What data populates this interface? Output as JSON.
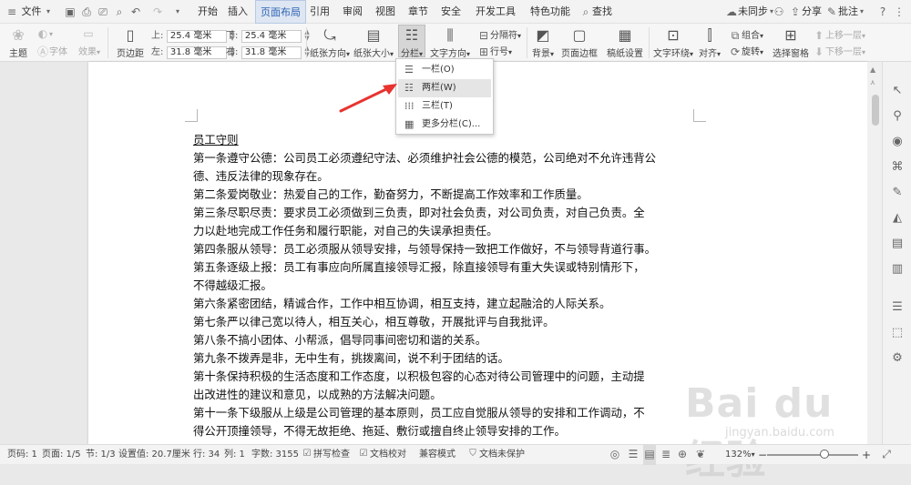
{
  "menubar": {
    "file_label": "文件",
    "tabs": [
      {
        "label": "开始"
      },
      {
        "label": "插入"
      },
      {
        "label": "页面布局",
        "active": true
      },
      {
        "label": "引用"
      },
      {
        "label": "审阅"
      },
      {
        "label": "视图"
      },
      {
        "label": "章节"
      },
      {
        "label": "安全"
      },
      {
        "label": "开发工具"
      },
      {
        "label": "特色功能"
      }
    ],
    "search_label": "查找",
    "sync_label": "未同步",
    "share_label": "分享",
    "comment_label": "批注"
  },
  "toolbar": {
    "theme_label": "主题",
    "font_label": "字体",
    "effect_label": "效果",
    "margin_button_label": "页边距",
    "margin_top_label": "上:",
    "margin_top_value": "25.4 毫米",
    "margin_bottom_label": "下:",
    "margin_bottom_value": "25.4 毫米",
    "margin_left_label": "左:",
    "margin_left_value": "31.8 毫米",
    "margin_right_label": "右:",
    "margin_right_value": "31.8 毫米",
    "orientation_label": "纸张方向",
    "size_label": "纸张大小",
    "columns_label": "分栏",
    "text_direction_label": "文字方向",
    "break_label": "分隔符",
    "line_number_label": "行号",
    "background_label": "背景",
    "page_border_label": "页面边框",
    "paper_setting_label": "稿纸设置",
    "text_wrap_label": "文字环绕",
    "align_label": "对齐",
    "rotate_label": "旋转",
    "group_label": "组合",
    "select_pane_label": "选择窗格",
    "bring_forward_label": "上移一层",
    "send_backward_label": "下移一层"
  },
  "columns_menu": {
    "items": [
      {
        "label": "一栏(O)"
      },
      {
        "label": "两栏(W)",
        "highlighted": true
      },
      {
        "label": "三栏(T)"
      },
      {
        "label": "更多分栏(C)..."
      }
    ]
  },
  "document": {
    "title": "员工守则",
    "paragraphs": [
      "第一条遵守公德：公司员工必须遵纪守法、必须维护社会公德的模范，公司绝对不允许违背公",
      "德、违反法律的现象存在。",
      "第二条爱岗敬业：热爱自己的工作，勤奋努力，不断提高工作效率和工作质量。",
      "第三条尽职尽责：要求员工必须做到三负责，即对社会负责，对公司负责，对自己负责。全",
      "力以赴地完成工作任务和履行职能，对自己的失误承担责任。",
      "第四条服从领导：员工必须服从领导安排，与领导保持一致把工作做好，不与领导背道行事。",
      "第五条逐级上报：员工有事应向所属直接领导汇报，除直接领导有重大失误或特别情形下，",
      "不得越级汇报。",
      "第六条紧密团结，精诚合作，工作中相互协调，相互支持，建立起融洽的人际关系。",
      "第七条严以律己宽以待人，相互关心，相互尊敬，开展批评与自我批评。",
      "第八条不搞小团体、小帮派，倡导同事间密切和谐的关系。",
      "第九条不拨弄是非，无中生有，挑拨离间，说不利于团结的话。",
      "第十条保持积极的生活态度和工作态度，以积极包容的心态对待公司管理中的问题，主动提",
      "出改进性的建议和意见，以成熟的方法解决问题。",
      "第十一条下级服从上级是公司管理的基本原则，员工应自觉服从领导的安排和工作调动，不",
      "得公开顶撞领导，不得无故拒绝、拖延、敷衍或擅自终止领导安排的工作。"
    ]
  },
  "statusbar": {
    "page_num": "页码: 1",
    "pages": "页面: 1/5",
    "section": "节: 1/3",
    "setting": "设置值: 20.7厘米",
    "row": "行: 34",
    "col": "列: 1",
    "words": "字数: 3155",
    "spell_check": "拼写检查",
    "doc_check": "文档校对",
    "compat_mode": "兼容模式",
    "protect": "文档未保护",
    "zoom": "132%"
  },
  "watermark": {
    "main": "Bai du 经验",
    "url": "jingyan.baidu.com"
  },
  "colors": {
    "active_tab": "#2f62b4",
    "arrow": "#e8332f"
  }
}
